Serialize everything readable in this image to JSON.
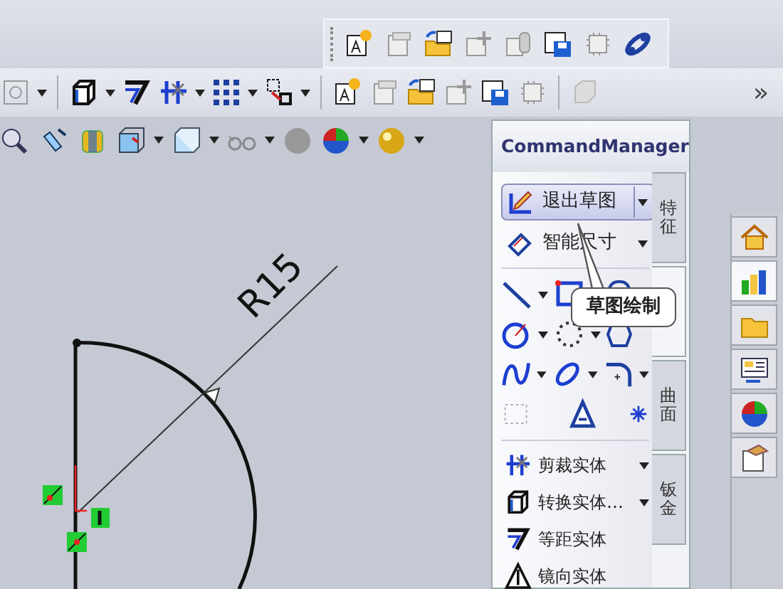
{
  "toolbar_overflow": "»",
  "command_manager": {
    "title": "CommandManager",
    "large_buttons": [
      {
        "label": "退出草图",
        "selected": true
      },
      {
        "label": "智能尺寸",
        "selected": false
      }
    ],
    "list_items": [
      {
        "label": "剪裁实体"
      },
      {
        "label": "转换实体…"
      },
      {
        "label": "等距实体"
      },
      {
        "label": "镜向实体"
      }
    ],
    "tabs": [
      {
        "label": "特征",
        "selected": false
      },
      {
        "selected": true
      },
      {
        "label": "曲面",
        "selected": false
      },
      {
        "label": "钣金",
        "selected": false
      }
    ]
  },
  "task_pane": {
    "tabs": [
      {
        "selected": false
      },
      {
        "selected": true
      },
      {
        "selected": false
      },
      {
        "selected": false
      },
      {
        "selected": false
      },
      {
        "selected": false
      }
    ]
  },
  "tooltip": "草图绘制",
  "sketch": {
    "dimension": "R15"
  }
}
